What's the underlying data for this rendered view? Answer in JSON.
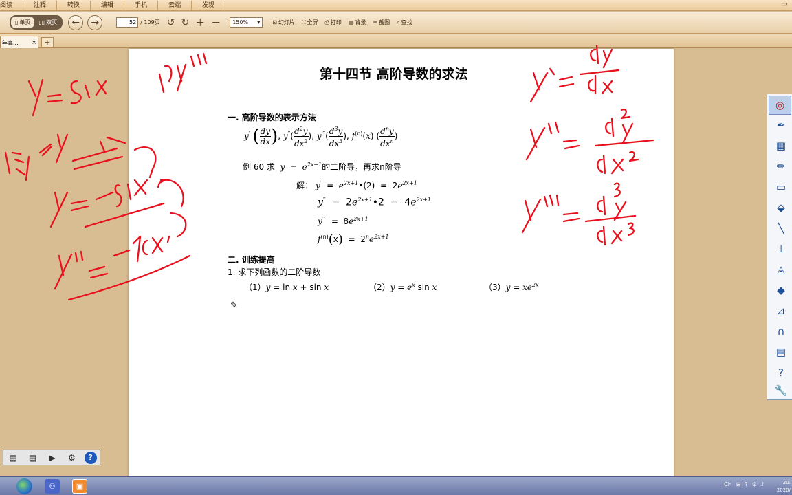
{
  "menu": {
    "items": [
      "阅读",
      "注释",
      "转换",
      "编辑",
      "手机",
      "云端",
      "发现"
    ]
  },
  "toolbar": {
    "single_page": "单页",
    "double_page": "双页",
    "current_page": "52",
    "total_pages": "/ 109页",
    "zoom": "150%",
    "slideshow": "幻灯片",
    "fullscreen": "全屏",
    "print": "打印",
    "background": "背景",
    "screenshot": "截图",
    "find": "查找"
  },
  "tab": {
    "label": "年高...",
    "close": "×",
    "add": "+"
  },
  "document": {
    "title": "第十四节 高阶导数的求法",
    "section1": "一. 高阶导数的表示方法",
    "example_prefix": "例 60 求",
    "example_suffix": "的二阶导，再求n阶导",
    "solution_label": "解：",
    "section2": "二. 训练提高",
    "exercise_intro": "1. 求下列函数的二阶导数",
    "exercises": [
      "（1）",
      "（2）",
      "（3）"
    ]
  },
  "taskbar": {
    "tray_lang": "CH",
    "clock_time": "20:",
    "clock_date": "2020/"
  }
}
